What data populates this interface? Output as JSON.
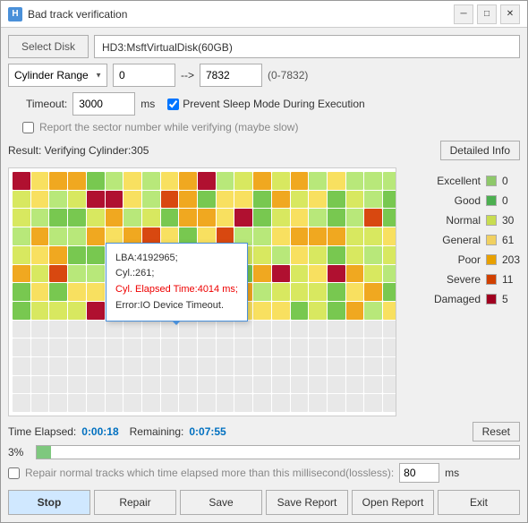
{
  "window": {
    "title": "Bad track verification",
    "icon": "HDD"
  },
  "toolbar": {
    "select_disk_label": "Select Disk",
    "disk_name": "HD3:MsftVirtualDisk(60GB)"
  },
  "cylinder_range": {
    "label": "Cylinder Range",
    "from": "0",
    "to": "7832",
    "range_hint": "(0-7832)"
  },
  "timeout": {
    "label": "Timeout:",
    "value": "3000",
    "unit": "ms"
  },
  "prevent_sleep": {
    "label": "Prevent Sleep Mode During Execution",
    "checked": true
  },
  "report_sector": {
    "label": "Report the sector number while verifying (maybe slow)",
    "checked": false
  },
  "result": {
    "text": "Result: Verifying Cylinder:305",
    "detail_btn": "Detailed Info"
  },
  "stats": {
    "excellent": {
      "label": "Excellent",
      "color": "#8ec86a",
      "value": "0"
    },
    "good": {
      "label": "Good",
      "color": "#4caf50",
      "value": "0"
    },
    "normal": {
      "label": "Normal",
      "color": "#c8dc50",
      "value": "30"
    },
    "general": {
      "label": "General",
      "color": "#f0d060",
      "value": "61"
    },
    "poor": {
      "label": "Poor",
      "color": "#e8a000",
      "value": "203"
    },
    "severe": {
      "label": "Severe",
      "color": "#d04000",
      "value": "11"
    },
    "damaged": {
      "label": "Damaged",
      "color": "#a00020",
      "value": "5"
    }
  },
  "timing": {
    "elapsed_label": "Time Elapsed:",
    "elapsed_value": "0:00:18",
    "remaining_label": "Remaining:",
    "remaining_value": "0:07:55",
    "reset_label": "Reset"
  },
  "progress": {
    "percent": "3%",
    "fill_pct": 3
  },
  "repair": {
    "label": "Repair normal tracks which time elapsed more than this millisecond(lossless):",
    "value": "80",
    "unit": "ms",
    "checked": false
  },
  "buttons": {
    "stop": "Stop",
    "repair": "Repair",
    "save": "Save",
    "save_report": "Save Report",
    "open_report": "Open Report",
    "exit": "Exit"
  },
  "tooltip": {
    "lba": "LBA:4192965;",
    "cyl": "Cyl.:261;",
    "elapsed": "Cyl. Elapsed Time:4014 ms;",
    "error": "Error:IO Device Timeout."
  }
}
